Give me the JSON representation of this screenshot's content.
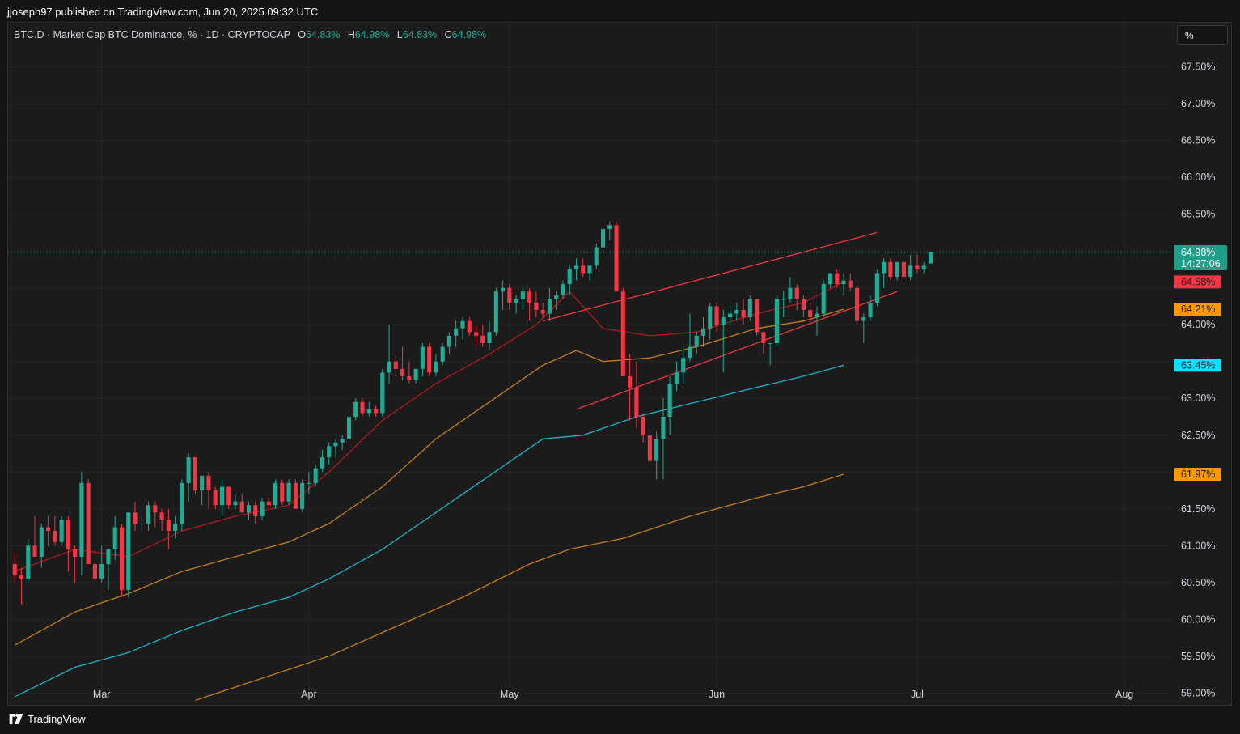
{
  "header": {
    "published": "jjoseph97 published on TradingView.com, Jun 20, 2025 09:32 UTC"
  },
  "legend": {
    "symbol": "BTC.D · Market Cap BTC Dominance, % · 1D · CRYPTOCAP",
    "o_label": "O",
    "o_value": "64.83%",
    "h_label": "H",
    "h_value": "64.98%",
    "l_label": "L",
    "l_value": "64.83%",
    "c_label": "C",
    "c_value": "64.98%"
  },
  "unit_button": "%",
  "footer": {
    "brand": "TradingView",
    "logo_icon": "tradingview-logo-icon"
  },
  "chart_data": {
    "type": "candlestick",
    "ylim": [
      58.85,
      68.1
    ],
    "y_ticks": [
      {
        "v": 67.5,
        "label": "67.50%"
      },
      {
        "v": 67.0,
        "label": "67.00%"
      },
      {
        "v": 66.5,
        "label": "66.50%"
      },
      {
        "v": 66.0,
        "label": "66.00%"
      },
      {
        "v": 65.5,
        "label": "65.50%"
      },
      {
        "v": 64.0,
        "label": "64.00%"
      },
      {
        "v": 63.0,
        "label": "63.00%"
      },
      {
        "v": 62.5,
        "label": "62.50%"
      },
      {
        "v": 61.5,
        "label": "61.50%"
      },
      {
        "v": 61.0,
        "label": "61.00%"
      },
      {
        "v": 60.5,
        "label": "60.50%"
      },
      {
        "v": 60.0,
        "label": "60.00%"
      },
      {
        "v": 59.5,
        "label": "59.50%"
      },
      {
        "v": 59.0,
        "label": "59.00%"
      }
    ],
    "x_ticks": [
      {
        "date": "2025-03-01",
        "label": "Mar"
      },
      {
        "date": "2025-04-01",
        "label": "Apr"
      },
      {
        "date": "2025-05-01",
        "label": "May"
      },
      {
        "date": "2025-06-01",
        "label": "Jun"
      },
      {
        "date": "2025-07-01",
        "label": "Jul"
      },
      {
        "date": "2025-08-01",
        "label": "Aug"
      }
    ],
    "x_range": [
      "2025-02-15",
      "2025-08-08"
    ],
    "first_date": "2025-02-16",
    "ohlc": [
      [
        60.75,
        60.9,
        60.5,
        60.6
      ],
      [
        60.6,
        60.7,
        60.2,
        60.55
      ],
      [
        60.55,
        61.1,
        60.5,
        61.0
      ],
      [
        61.0,
        61.4,
        60.9,
        60.85
      ],
      [
        60.85,
        61.3,
        60.7,
        61.25
      ],
      [
        61.25,
        61.4,
        61.0,
        61.2
      ],
      [
        61.2,
        61.4,
        61.0,
        61.05
      ],
      [
        61.05,
        61.4,
        61.0,
        61.35
      ],
      [
        61.35,
        61.4,
        60.65,
        60.95
      ],
      [
        60.95,
        61.0,
        60.5,
        60.85
      ],
      [
        60.85,
        62.0,
        60.6,
        61.85
      ],
      [
        61.85,
        61.9,
        61.0,
        60.75
      ],
      [
        60.75,
        60.9,
        60.5,
        60.55
      ],
      [
        60.55,
        61.0,
        60.5,
        60.75
      ],
      [
        60.75,
        60.8,
        60.4,
        60.95
      ],
      [
        60.95,
        61.4,
        60.8,
        61.25
      ],
      [
        61.25,
        61.3,
        60.3,
        60.4
      ],
      [
        60.4,
        61.4,
        60.3,
        61.45
      ],
      [
        61.45,
        61.6,
        61.2,
        61.3
      ],
      [
        61.3,
        61.4,
        61.2,
        61.3
      ],
      [
        61.3,
        61.6,
        61.2,
        61.55
      ],
      [
        61.55,
        61.6,
        61.25,
        61.45
      ],
      [
        61.45,
        61.5,
        61.2,
        61.35
      ],
      [
        61.35,
        61.5,
        60.95,
        61.2
      ],
      [
        61.2,
        61.4,
        61.1,
        61.3
      ],
      [
        61.3,
        61.9,
        61.2,
        61.85
      ],
      [
        61.85,
        62.25,
        61.6,
        62.2
      ],
      [
        62.2,
        62.2,
        61.7,
        61.75
      ],
      [
        61.75,
        61.95,
        61.55,
        61.95
      ],
      [
        61.95,
        62.0,
        61.5,
        61.75
      ],
      [
        61.75,
        61.8,
        61.5,
        61.55
      ],
      [
        61.55,
        61.9,
        61.4,
        61.8
      ],
      [
        61.8,
        61.8,
        61.5,
        61.55
      ],
      [
        61.55,
        61.7,
        61.5,
        61.6
      ],
      [
        61.6,
        61.7,
        61.5,
        61.45
      ],
      [
        61.45,
        61.6,
        61.35,
        61.55
      ],
      [
        61.55,
        61.6,
        61.3,
        61.4
      ],
      [
        61.4,
        61.65,
        61.35,
        61.6
      ],
      [
        61.6,
        61.65,
        61.5,
        61.55
      ],
      [
        61.55,
        61.9,
        61.5,
        61.85
      ],
      [
        61.85,
        61.9,
        61.55,
        61.6
      ],
      [
        61.6,
        61.9,
        61.55,
        61.85
      ],
      [
        61.85,
        61.9,
        61.5,
        61.5
      ],
      [
        61.5,
        61.9,
        61.45,
        61.85
      ],
      [
        61.85,
        62.0,
        61.7,
        61.85
      ],
      [
        61.85,
        62.1,
        61.8,
        62.05
      ],
      [
        62.05,
        62.3,
        62.0,
        62.2
      ],
      [
        62.2,
        62.4,
        62.1,
        62.35
      ],
      [
        62.35,
        62.45,
        62.2,
        62.4
      ],
      [
        62.4,
        62.5,
        62.3,
        62.45
      ],
      [
        62.45,
        62.8,
        62.4,
        62.75
      ],
      [
        62.75,
        63.0,
        62.7,
        62.95
      ],
      [
        62.95,
        63.0,
        62.75,
        62.8
      ],
      [
        62.8,
        62.95,
        62.75,
        62.85
      ],
      [
        62.85,
        62.9,
        62.75,
        62.8
      ],
      [
        62.8,
        63.4,
        62.75,
        63.35
      ],
      [
        63.35,
        64.0,
        63.2,
        63.5
      ],
      [
        63.5,
        63.6,
        63.3,
        63.4
      ],
      [
        63.4,
        63.7,
        63.25,
        63.3
      ],
      [
        63.3,
        63.5,
        63.2,
        63.25
      ],
      [
        63.25,
        63.4,
        63.2,
        63.4
      ],
      [
        63.4,
        63.75,
        63.3,
        63.7
      ],
      [
        63.7,
        63.75,
        63.3,
        63.35
      ],
      [
        63.35,
        63.6,
        63.3,
        63.5
      ],
      [
        63.5,
        63.75,
        63.45,
        63.7
      ],
      [
        63.7,
        63.9,
        63.6,
        63.85
      ],
      [
        63.85,
        64.05,
        63.7,
        63.95
      ],
      [
        63.95,
        64.1,
        63.8,
        64.05
      ],
      [
        64.05,
        64.1,
        63.85,
        63.9
      ],
      [
        63.9,
        64.0,
        63.7,
        63.85
      ],
      [
        63.85,
        64.0,
        63.7,
        63.75
      ],
      [
        63.75,
        64.05,
        63.65,
        63.9
      ],
      [
        63.9,
        64.5,
        63.85,
        64.45
      ],
      [
        64.45,
        64.6,
        64.2,
        64.5
      ],
      [
        64.5,
        64.55,
        64.2,
        64.3
      ],
      [
        64.3,
        64.4,
        64.15,
        64.35
      ],
      [
        64.35,
        64.5,
        64.2,
        64.45
      ],
      [
        64.45,
        64.5,
        64.05,
        64.3
      ],
      [
        64.3,
        64.45,
        64.1,
        64.2
      ],
      [
        64.2,
        64.3,
        64.1,
        64.15
      ],
      [
        64.15,
        64.5,
        64.05,
        64.35
      ],
      [
        64.35,
        64.45,
        64.2,
        64.4
      ],
      [
        64.4,
        64.6,
        64.35,
        64.55
      ],
      [
        64.55,
        64.8,
        64.4,
        64.75
      ],
      [
        64.75,
        64.9,
        64.6,
        64.8
      ],
      [
        64.8,
        64.9,
        64.65,
        64.7
      ],
      [
        64.7,
        64.8,
        64.6,
        64.8
      ],
      [
        64.8,
        65.1,
        64.75,
        65.05
      ],
      [
        65.05,
        65.4,
        65.0,
        65.3
      ],
      [
        65.3,
        65.4,
        65.15,
        65.35
      ],
      [
        65.35,
        65.4,
        64.6,
        64.45
      ],
      [
        64.45,
        64.5,
        63.5,
        63.3
      ],
      [
        63.3,
        63.6,
        62.7,
        63.15
      ],
      [
        63.15,
        63.5,
        62.6,
        62.75
      ],
      [
        62.75,
        62.8,
        62.4,
        62.5
      ],
      [
        62.5,
        62.6,
        62.2,
        62.15
      ],
      [
        62.15,
        62.55,
        61.9,
        62.45
      ],
      [
        62.45,
        63.0,
        61.9,
        62.75
      ],
      [
        62.75,
        63.3,
        62.5,
        63.2
      ],
      [
        63.2,
        63.5,
        63.1,
        63.35
      ],
      [
        63.35,
        63.7,
        63.2,
        63.55
      ],
      [
        63.55,
        64.15,
        63.5,
        63.7
      ],
      [
        63.7,
        63.9,
        63.6,
        63.85
      ],
      [
        63.85,
        64.1,
        63.7,
        63.95
      ],
      [
        63.95,
        64.3,
        63.8,
        64.25
      ],
      [
        64.25,
        64.3,
        63.9,
        64.0
      ],
      [
        64.0,
        64.2,
        63.35,
        64.1
      ],
      [
        64.1,
        64.25,
        64.0,
        64.15
      ],
      [
        64.15,
        64.3,
        64.05,
        64.2
      ],
      [
        64.2,
        64.35,
        64.0,
        64.1
      ],
      [
        64.1,
        64.4,
        64.05,
        64.35
      ],
      [
        64.35,
        64.35,
        63.85,
        63.9
      ],
      [
        63.9,
        63.9,
        63.6,
        63.75
      ],
      [
        63.75,
        63.75,
        63.45,
        63.75
      ],
      [
        63.75,
        64.4,
        63.7,
        64.35
      ],
      [
        64.35,
        64.45,
        64.1,
        64.35
      ],
      [
        64.35,
        64.65,
        64.3,
        64.5
      ],
      [
        64.5,
        64.55,
        64.2,
        64.35
      ],
      [
        64.35,
        64.4,
        64.1,
        64.2
      ],
      [
        64.2,
        64.3,
        64.0,
        64.1
      ],
      [
        64.1,
        64.25,
        63.85,
        64.15
      ],
      [
        64.15,
        64.6,
        64.1,
        64.55
      ],
      [
        64.55,
        64.7,
        64.5,
        64.7
      ],
      [
        64.7,
        64.75,
        64.5,
        64.55
      ],
      [
        64.55,
        64.7,
        64.4,
        64.6
      ],
      [
        64.6,
        64.7,
        64.45,
        64.5
      ],
      [
        64.5,
        64.6,
        64.0,
        64.05
      ],
      [
        64.05,
        64.15,
        63.75,
        64.1
      ],
      [
        64.1,
        64.4,
        64.05,
        64.3
      ],
      [
        64.3,
        64.75,
        64.25,
        64.7
      ],
      [
        64.7,
        64.9,
        64.5,
        64.85
      ],
      [
        64.85,
        64.9,
        64.6,
        64.65
      ],
      [
        64.65,
        64.85,
        64.6,
        64.85
      ],
      [
        64.85,
        64.9,
        64.6,
        64.65
      ],
      [
        64.65,
        64.95,
        64.6,
        64.8
      ],
      [
        64.8,
        64.95,
        64.7,
        64.75
      ],
      [
        64.75,
        64.85,
        64.7,
        64.8
      ],
      [
        64.83,
        64.98,
        64.83,
        64.98
      ]
    ],
    "moving_averages": [
      {
        "color": "#b2191f",
        "label": "64.58%",
        "label_bg": "#f23645",
        "points": [
          [
            "2025-02-16",
            60.65
          ],
          [
            "2025-02-25",
            60.95
          ],
          [
            "2025-03-05",
            60.85
          ],
          [
            "2025-03-13",
            61.2
          ],
          [
            "2025-03-21",
            61.4
          ],
          [
            "2025-03-29",
            61.55
          ],
          [
            "2025-04-04",
            62.0
          ],
          [
            "2025-04-12",
            62.7
          ],
          [
            "2025-04-20",
            63.2
          ],
          [
            "2025-04-28",
            63.6
          ],
          [
            "2025-05-05",
            64.0
          ],
          [
            "2025-05-10",
            64.45
          ],
          [
            "2025-05-15",
            63.95
          ],
          [
            "2025-05-22",
            63.85
          ],
          [
            "2025-05-29",
            63.9
          ],
          [
            "2025-06-07",
            64.15
          ],
          [
            "2025-06-14",
            64.3
          ],
          [
            "2025-06-20",
            64.58
          ]
        ]
      },
      {
        "color": "#c47e1e",
        "label": "64.21%",
        "label_bg": "#ff9800",
        "points": [
          [
            "2025-02-16",
            59.65
          ],
          [
            "2025-02-25",
            60.1
          ],
          [
            "2025-03-05",
            60.35
          ],
          [
            "2025-03-13",
            60.65
          ],
          [
            "2025-03-21",
            60.85
          ],
          [
            "2025-03-29",
            61.05
          ],
          [
            "2025-04-04",
            61.3
          ],
          [
            "2025-04-12",
            61.8
          ],
          [
            "2025-04-20",
            62.45
          ],
          [
            "2025-04-28",
            62.95
          ],
          [
            "2025-05-06",
            63.45
          ],
          [
            "2025-05-11",
            63.65
          ],
          [
            "2025-05-15",
            63.5
          ],
          [
            "2025-05-22",
            63.55
          ],
          [
            "2025-05-29",
            63.7
          ],
          [
            "2025-06-07",
            63.95
          ],
          [
            "2025-06-14",
            64.05
          ],
          [
            "2025-06-20",
            64.21
          ]
        ]
      },
      {
        "color": "#1bb3c6",
        "label": "63.45%",
        "label_bg": "#00e5ff",
        "points": [
          [
            "2025-02-16",
            58.95
          ],
          [
            "2025-02-25",
            59.35
          ],
          [
            "2025-03-05",
            59.55
          ],
          [
            "2025-03-13",
            59.85
          ],
          [
            "2025-03-21",
            60.1
          ],
          [
            "2025-03-29",
            60.3
          ],
          [
            "2025-04-04",
            60.55
          ],
          [
            "2025-04-12",
            60.95
          ],
          [
            "2025-04-20",
            61.45
          ],
          [
            "2025-04-28",
            61.95
          ],
          [
            "2025-05-06",
            62.45
          ],
          [
            "2025-05-12",
            62.5
          ],
          [
            "2025-05-20",
            62.75
          ],
          [
            "2025-05-29",
            62.95
          ],
          [
            "2025-06-07",
            63.15
          ],
          [
            "2025-06-14",
            63.3
          ],
          [
            "2025-06-20",
            63.45
          ]
        ]
      },
      {
        "color": "#c47e1e",
        "label": "61.97%",
        "label_bg": "#ff9800",
        "points": [
          [
            "2025-03-15",
            58.9
          ],
          [
            "2025-03-25",
            59.2
          ],
          [
            "2025-04-04",
            59.5
          ],
          [
            "2025-04-14",
            59.9
          ],
          [
            "2025-04-24",
            60.3
          ],
          [
            "2025-05-04",
            60.75
          ],
          [
            "2025-05-10",
            60.95
          ],
          [
            "2025-05-18",
            61.1
          ],
          [
            "2025-05-28",
            61.4
          ],
          [
            "2025-06-07",
            61.65
          ],
          [
            "2025-06-14",
            61.8
          ],
          [
            "2025-06-20",
            61.97
          ]
        ]
      }
    ],
    "trendlines": [
      {
        "color": "#f23645",
        "from": [
          "2025-05-06",
          64.05
        ],
        "to": [
          "2025-06-25",
          65.25
        ]
      },
      {
        "color": "#f23645",
        "from": [
          "2025-05-11",
          62.85
        ],
        "to": [
          "2025-06-28",
          64.45
        ]
      }
    ],
    "last_price": {
      "value": 64.98,
      "label": "64.98%",
      "countdown": "14:27:06"
    }
  }
}
